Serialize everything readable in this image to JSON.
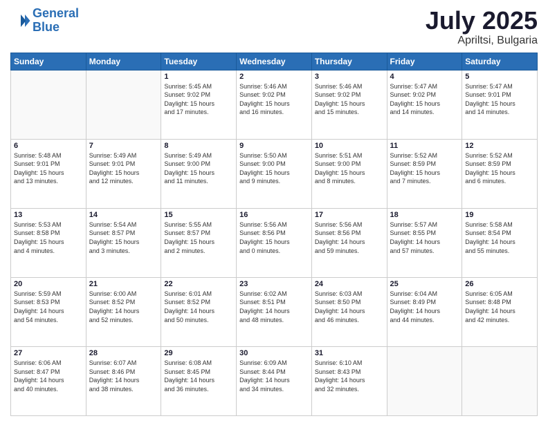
{
  "header": {
    "logo_line1": "General",
    "logo_line2": "Blue",
    "month": "July 2025",
    "location": "Apriltsi, Bulgaria"
  },
  "weekdays": [
    "Sunday",
    "Monday",
    "Tuesday",
    "Wednesday",
    "Thursday",
    "Friday",
    "Saturday"
  ],
  "weeks": [
    [
      {
        "day": "",
        "info": ""
      },
      {
        "day": "",
        "info": ""
      },
      {
        "day": "1",
        "info": "Sunrise: 5:45 AM\nSunset: 9:02 PM\nDaylight: 15 hours\nand 17 minutes."
      },
      {
        "day": "2",
        "info": "Sunrise: 5:46 AM\nSunset: 9:02 PM\nDaylight: 15 hours\nand 16 minutes."
      },
      {
        "day": "3",
        "info": "Sunrise: 5:46 AM\nSunset: 9:02 PM\nDaylight: 15 hours\nand 15 minutes."
      },
      {
        "day": "4",
        "info": "Sunrise: 5:47 AM\nSunset: 9:02 PM\nDaylight: 15 hours\nand 14 minutes."
      },
      {
        "day": "5",
        "info": "Sunrise: 5:47 AM\nSunset: 9:01 PM\nDaylight: 15 hours\nand 14 minutes."
      }
    ],
    [
      {
        "day": "6",
        "info": "Sunrise: 5:48 AM\nSunset: 9:01 PM\nDaylight: 15 hours\nand 13 minutes."
      },
      {
        "day": "7",
        "info": "Sunrise: 5:49 AM\nSunset: 9:01 PM\nDaylight: 15 hours\nand 12 minutes."
      },
      {
        "day": "8",
        "info": "Sunrise: 5:49 AM\nSunset: 9:00 PM\nDaylight: 15 hours\nand 11 minutes."
      },
      {
        "day": "9",
        "info": "Sunrise: 5:50 AM\nSunset: 9:00 PM\nDaylight: 15 hours\nand 9 minutes."
      },
      {
        "day": "10",
        "info": "Sunrise: 5:51 AM\nSunset: 9:00 PM\nDaylight: 15 hours\nand 8 minutes."
      },
      {
        "day": "11",
        "info": "Sunrise: 5:52 AM\nSunset: 8:59 PM\nDaylight: 15 hours\nand 7 minutes."
      },
      {
        "day": "12",
        "info": "Sunrise: 5:52 AM\nSunset: 8:59 PM\nDaylight: 15 hours\nand 6 minutes."
      }
    ],
    [
      {
        "day": "13",
        "info": "Sunrise: 5:53 AM\nSunset: 8:58 PM\nDaylight: 15 hours\nand 4 minutes."
      },
      {
        "day": "14",
        "info": "Sunrise: 5:54 AM\nSunset: 8:57 PM\nDaylight: 15 hours\nand 3 minutes."
      },
      {
        "day": "15",
        "info": "Sunrise: 5:55 AM\nSunset: 8:57 PM\nDaylight: 15 hours\nand 2 minutes."
      },
      {
        "day": "16",
        "info": "Sunrise: 5:56 AM\nSunset: 8:56 PM\nDaylight: 15 hours\nand 0 minutes."
      },
      {
        "day": "17",
        "info": "Sunrise: 5:56 AM\nSunset: 8:56 PM\nDaylight: 14 hours\nand 59 minutes."
      },
      {
        "day": "18",
        "info": "Sunrise: 5:57 AM\nSunset: 8:55 PM\nDaylight: 14 hours\nand 57 minutes."
      },
      {
        "day": "19",
        "info": "Sunrise: 5:58 AM\nSunset: 8:54 PM\nDaylight: 14 hours\nand 55 minutes."
      }
    ],
    [
      {
        "day": "20",
        "info": "Sunrise: 5:59 AM\nSunset: 8:53 PM\nDaylight: 14 hours\nand 54 minutes."
      },
      {
        "day": "21",
        "info": "Sunrise: 6:00 AM\nSunset: 8:52 PM\nDaylight: 14 hours\nand 52 minutes."
      },
      {
        "day": "22",
        "info": "Sunrise: 6:01 AM\nSunset: 8:52 PM\nDaylight: 14 hours\nand 50 minutes."
      },
      {
        "day": "23",
        "info": "Sunrise: 6:02 AM\nSunset: 8:51 PM\nDaylight: 14 hours\nand 48 minutes."
      },
      {
        "day": "24",
        "info": "Sunrise: 6:03 AM\nSunset: 8:50 PM\nDaylight: 14 hours\nand 46 minutes."
      },
      {
        "day": "25",
        "info": "Sunrise: 6:04 AM\nSunset: 8:49 PM\nDaylight: 14 hours\nand 44 minutes."
      },
      {
        "day": "26",
        "info": "Sunrise: 6:05 AM\nSunset: 8:48 PM\nDaylight: 14 hours\nand 42 minutes."
      }
    ],
    [
      {
        "day": "27",
        "info": "Sunrise: 6:06 AM\nSunset: 8:47 PM\nDaylight: 14 hours\nand 40 minutes."
      },
      {
        "day": "28",
        "info": "Sunrise: 6:07 AM\nSunset: 8:46 PM\nDaylight: 14 hours\nand 38 minutes."
      },
      {
        "day": "29",
        "info": "Sunrise: 6:08 AM\nSunset: 8:45 PM\nDaylight: 14 hours\nand 36 minutes."
      },
      {
        "day": "30",
        "info": "Sunrise: 6:09 AM\nSunset: 8:44 PM\nDaylight: 14 hours\nand 34 minutes."
      },
      {
        "day": "31",
        "info": "Sunrise: 6:10 AM\nSunset: 8:43 PM\nDaylight: 14 hours\nand 32 minutes."
      },
      {
        "day": "",
        "info": ""
      },
      {
        "day": "",
        "info": ""
      }
    ]
  ]
}
